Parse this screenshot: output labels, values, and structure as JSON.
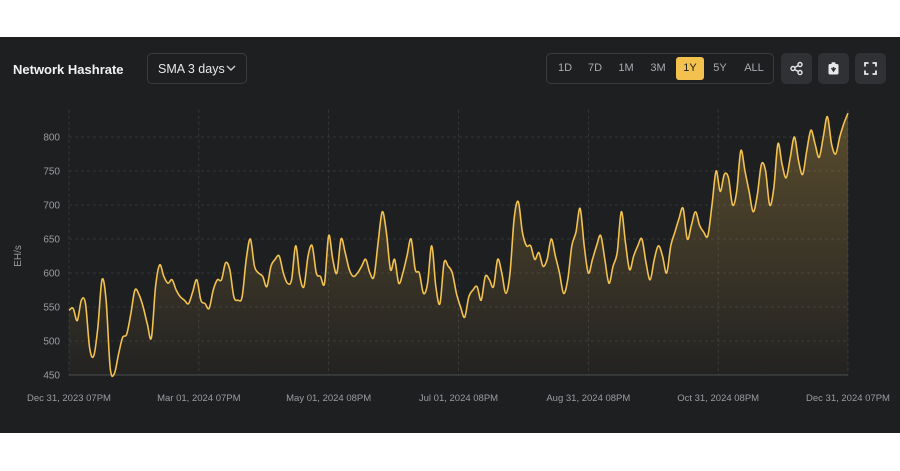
{
  "header": {
    "title": "Network Hashrate"
  },
  "dropdown": {
    "label": "SMA 3 days"
  },
  "ranges": [
    "1D",
    "7D",
    "1M",
    "3M",
    "1Y",
    "5Y",
    "ALL"
  ],
  "active_range": "1Y",
  "icons": [
    "share-icon",
    "camera-icon",
    "fullscreen-icon"
  ],
  "colors": {
    "line": "#f2c14e",
    "panel": "#1e1f21",
    "grid": "#3b3d40",
    "axis_text": "#9a9ca1"
  },
  "chart_data": {
    "type": "area",
    "ylabel": "EH/s",
    "ylim": [
      450,
      840
    ],
    "yticks": [
      450,
      500,
      550,
      600,
      650,
      700,
      750,
      800
    ],
    "xticks": [
      "Dec 31, 2023 07PM",
      "Mar 01, 2024 07PM",
      "May 01, 2024 08PM",
      "Jul 01, 2024 08PM",
      "Aug 31, 2024 08PM",
      "Oct 31, 2024 08PM",
      "Dec 31, 2024 07PM"
    ],
    "x_start": "2023-12-31",
    "x_end": "2024-12-31",
    "grid": true,
    "series": [
      {
        "values": [
          545,
          548,
          530,
          560,
          555,
          490,
          478,
          520,
          590,
          560,
          460,
          452,
          480,
          505,
          510,
          540,
          575,
          568,
          550,
          525,
          505,
          580,
          612,
          595,
          585,
          590,
          575,
          565,
          560,
          555,
          572,
          590,
          560,
          555,
          548,
          575,
          590,
          590,
          615,
          605,
          565,
          560,
          565,
          620,
          650,
          610,
          600,
          595,
          580,
          610,
          620,
          625,
          600,
          585,
          590,
          640,
          595,
          580,
          625,
          640,
          600,
          595,
          585,
          655,
          620,
          600,
          650,
          630,
          605,
          595,
          600,
          610,
          620,
          600,
          595,
          645,
          690,
          660,
          605,
          620,
          585,
          600,
          625,
          650,
          605,
          600,
          570,
          585,
          640,
          580,
          555,
          615,
          610,
          600,
          570,
          550,
          535,
          565,
          575,
          580,
          560,
          595,
          590,
          580,
          620,
          600,
          570,
          600,
          680,
          705,
          660,
          640,
          640,
          620,
          630,
          610,
          620,
          650,
          625,
          600,
          570,
          590,
          640,
          660,
          695,
          640,
          600,
          620,
          640,
          655,
          620,
          585,
          610,
          630,
          690,
          645,
          605,
          625,
          640,
          650,
          615,
          590,
          620,
          640,
          625,
          600,
          640,
          660,
          680,
          695,
          650,
          670,
          690,
          670,
          660,
          655,
          700,
          750,
          720,
          745,
          740,
          700,
          720,
          780,
          750,
          720,
          690,
          715,
          760,
          750,
          700,
          725,
          790,
          760,
          740,
          770,
          800,
          765,
          745,
          780,
          810,
          790,
          770,
          800,
          830,
          790,
          775,
          800,
          820,
          835
        ]
      }
    ]
  }
}
